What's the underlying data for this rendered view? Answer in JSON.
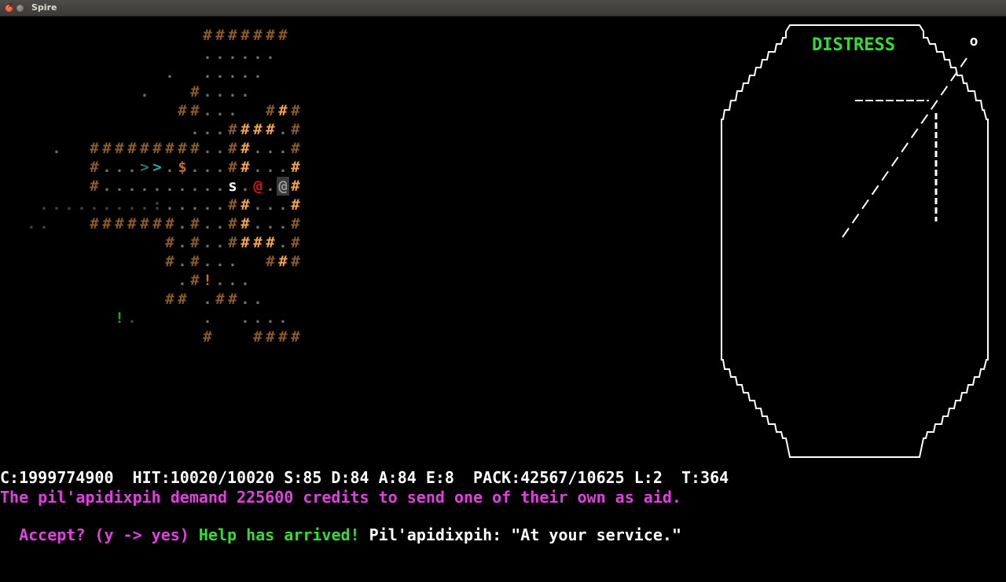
{
  "window": {
    "title": "Spire"
  },
  "colors": {
    "wall": "#8a5a2c",
    "wall_lit": "#f0a24a",
    "floor": "#6e6e6e",
    "floor_dim": "#444444",
    "credits": "#c2682c",
    "stairs": "#2aa6a6",
    "stairs_dim": "#2f6f6f",
    "enemy_red": "#dd1111",
    "npc_grey": "#8a8a8a",
    "potion_green": "#22aa22",
    "item_orange": "#d2691e",
    "text_white": "#ffffff",
    "text_magenta": "#e040e0",
    "text_green": "#33dd33",
    "distress": "#33dd33"
  },
  "map": {
    "rows": [
      {
        "y": 1,
        "cells": [
          [
            16,
            "#",
            "wall"
          ],
          [
            17,
            "#",
            "wall"
          ],
          [
            18,
            "#",
            "wall"
          ],
          [
            19,
            "#",
            "wall"
          ],
          [
            20,
            "#",
            "wall"
          ],
          [
            21,
            "#",
            "wall"
          ],
          [
            22,
            "#",
            "wall"
          ]
        ]
      },
      {
        "y": 2,
        "cells": [
          [
            16,
            ".",
            "floor"
          ],
          [
            17,
            ".",
            "floor"
          ],
          [
            18,
            ".",
            "floor"
          ],
          [
            19,
            ".",
            "floor"
          ],
          [
            20,
            ".",
            "floor"
          ],
          [
            21,
            ".",
            "floor"
          ]
        ]
      },
      {
        "y": 3,
        "cells": [
          [
            13,
            ".",
            "floor"
          ],
          [
            16,
            ".",
            "floor"
          ],
          [
            17,
            ".",
            "floor"
          ],
          [
            18,
            ".",
            "floor"
          ],
          [
            19,
            ".",
            "floor"
          ],
          [
            20,
            ".",
            "floor"
          ]
        ]
      },
      {
        "y": 4,
        "cells": [
          [
            11,
            ".",
            "floor"
          ],
          [
            15,
            "#",
            "wall"
          ],
          [
            16,
            ".",
            "floor"
          ],
          [
            17,
            ".",
            "floor"
          ],
          [
            18,
            ".",
            "floor"
          ],
          [
            19,
            ".",
            "floor"
          ]
        ]
      },
      {
        "y": 5,
        "cells": [
          [
            14,
            "#",
            "wall"
          ],
          [
            15,
            "#",
            "wall"
          ],
          [
            16,
            ".",
            "floor"
          ],
          [
            17,
            ".",
            "floor"
          ],
          [
            18,
            ".",
            "floor"
          ],
          [
            21,
            "#",
            "wall"
          ],
          [
            22,
            "#",
            "wall_lit"
          ],
          [
            23,
            "#",
            "wall"
          ]
        ]
      },
      {
        "y": 6,
        "cells": [
          [
            15,
            ".",
            "floor"
          ],
          [
            16,
            ".",
            "floor"
          ],
          [
            17,
            ".",
            "floor"
          ],
          [
            18,
            "#",
            "wall"
          ],
          [
            19,
            "#",
            "wall_lit"
          ],
          [
            20,
            "#",
            "wall_lit"
          ],
          [
            21,
            "#",
            "wall_lit"
          ],
          [
            22,
            ".",
            "floor"
          ],
          [
            23,
            "#",
            "wall"
          ]
        ]
      },
      {
        "y": 7,
        "cells": [
          [
            4,
            ".",
            "floor"
          ],
          [
            7,
            "#",
            "wall"
          ],
          [
            8,
            "#",
            "wall"
          ],
          [
            9,
            "#",
            "wall"
          ],
          [
            10,
            "#",
            "wall"
          ],
          [
            11,
            "#",
            "wall"
          ],
          [
            12,
            "#",
            "wall"
          ],
          [
            13,
            "#",
            "wall"
          ],
          [
            14,
            "#",
            "wall"
          ],
          [
            15,
            "#",
            "wall"
          ],
          [
            16,
            ".",
            "floor"
          ],
          [
            17,
            ".",
            "floor"
          ],
          [
            18,
            "#",
            "wall"
          ],
          [
            19,
            "#",
            "wall_lit"
          ],
          [
            20,
            ".",
            "floor"
          ],
          [
            21,
            ".",
            "floor"
          ],
          [
            22,
            ".",
            "floor"
          ],
          [
            23,
            "#",
            "wall"
          ]
        ]
      },
      {
        "y": 8,
        "cells": [
          [
            7,
            "#",
            "wall"
          ],
          [
            8,
            ".",
            "floor"
          ],
          [
            9,
            ".",
            "floor"
          ],
          [
            10,
            ".",
            "floor"
          ],
          [
            11,
            ">",
            "stairs_dim"
          ],
          [
            12,
            ">",
            "stairs"
          ],
          [
            13,
            ".",
            "floor"
          ],
          [
            14,
            "$",
            "credits"
          ],
          [
            15,
            ".",
            "floor"
          ],
          [
            16,
            ".",
            "floor"
          ],
          [
            17,
            ".",
            "floor"
          ],
          [
            18,
            "#",
            "wall"
          ],
          [
            19,
            "#",
            "wall_lit"
          ],
          [
            20,
            ".",
            "floor"
          ],
          [
            21,
            ".",
            "floor"
          ],
          [
            22,
            ".",
            "floor"
          ],
          [
            23,
            "#",
            "wall_lit"
          ]
        ]
      },
      {
        "y": 9,
        "cells": [
          [
            7,
            "#",
            "wall"
          ],
          [
            8,
            ".",
            "floor"
          ],
          [
            9,
            ".",
            "floor"
          ],
          [
            10,
            ".",
            "floor"
          ],
          [
            11,
            ".",
            "floor"
          ],
          [
            12,
            ".",
            "floor"
          ],
          [
            13,
            ".",
            "floor"
          ],
          [
            14,
            ".",
            "floor"
          ],
          [
            15,
            ".",
            "floor"
          ],
          [
            16,
            ".",
            "floor"
          ],
          [
            17,
            ".",
            "floor"
          ],
          [
            18,
            "s",
            "text_white"
          ],
          [
            19,
            ".",
            "floor"
          ],
          [
            20,
            "@",
            "enemy_red"
          ],
          [
            21,
            ".",
            "floor"
          ],
          [
            22,
            "@",
            "npc_grey"
          ],
          [
            23,
            "#",
            "wall_lit"
          ]
        ]
      },
      {
        "y": 10,
        "cells": [
          [
            3,
            ".",
            "floor_dim"
          ],
          [
            4,
            ".",
            "floor_dim"
          ],
          [
            5,
            ".",
            "floor_dim"
          ],
          [
            6,
            ".",
            "floor_dim"
          ],
          [
            7,
            ".",
            "floor_dim"
          ],
          [
            8,
            ".",
            "floor_dim"
          ],
          [
            9,
            ".",
            "floor_dim"
          ],
          [
            10,
            ".",
            "floor_dim"
          ],
          [
            11,
            ".",
            "floor_dim"
          ],
          [
            12,
            ":",
            "floor_dim"
          ],
          [
            13,
            ".",
            "floor"
          ],
          [
            14,
            ".",
            "floor"
          ],
          [
            15,
            ".",
            "floor"
          ],
          [
            16,
            ".",
            "floor"
          ],
          [
            17,
            ".",
            "floor"
          ],
          [
            18,
            "#",
            "wall"
          ],
          [
            19,
            "#",
            "wall_lit"
          ],
          [
            20,
            ".",
            "floor"
          ],
          [
            21,
            ".",
            "floor"
          ],
          [
            22,
            ".",
            "floor"
          ],
          [
            23,
            "#",
            "wall_lit"
          ]
        ]
      },
      {
        "y": 11,
        "cells": [
          [
            2,
            ".",
            "floor_dim"
          ],
          [
            3,
            ".",
            "floor_dim"
          ],
          [
            7,
            "#",
            "wall"
          ],
          [
            8,
            "#",
            "wall"
          ],
          [
            9,
            "#",
            "wall"
          ],
          [
            10,
            "#",
            "wall"
          ],
          [
            11,
            "#",
            "wall"
          ],
          [
            12,
            "#",
            "wall"
          ],
          [
            13,
            "#",
            "wall"
          ],
          [
            14,
            ".",
            "floor"
          ],
          [
            15,
            "#",
            "wall"
          ],
          [
            16,
            ".",
            "floor"
          ],
          [
            17,
            ".",
            "floor"
          ],
          [
            18,
            "#",
            "wall"
          ],
          [
            19,
            "#",
            "wall_lit"
          ],
          [
            20,
            ".",
            "floor"
          ],
          [
            21,
            ".",
            "floor"
          ],
          [
            22,
            ".",
            "floor"
          ],
          [
            23,
            "#",
            "wall"
          ]
        ]
      },
      {
        "y": 12,
        "cells": [
          [
            13,
            "#",
            "wall"
          ],
          [
            14,
            ".",
            "floor"
          ],
          [
            15,
            "#",
            "wall"
          ],
          [
            16,
            ".",
            "floor"
          ],
          [
            17,
            ".",
            "floor"
          ],
          [
            18,
            "#",
            "wall"
          ],
          [
            19,
            "#",
            "wall_lit"
          ],
          [
            20,
            "#",
            "wall_lit"
          ],
          [
            21,
            "#",
            "wall_lit"
          ],
          [
            22,
            ".",
            "floor"
          ],
          [
            23,
            "#",
            "wall"
          ]
        ]
      },
      {
        "y": 13,
        "cells": [
          [
            13,
            "#",
            "wall"
          ],
          [
            14,
            ".",
            "floor"
          ],
          [
            15,
            "#",
            "wall"
          ],
          [
            16,
            ".",
            "floor"
          ],
          [
            17,
            ".",
            "floor"
          ],
          [
            18,
            ".",
            "floor"
          ],
          [
            21,
            "#",
            "wall"
          ],
          [
            22,
            "#",
            "wall_lit"
          ],
          [
            23,
            "#",
            "wall"
          ]
        ]
      },
      {
        "y": 14,
        "cells": [
          [
            14,
            ".",
            "floor"
          ],
          [
            15,
            "#",
            "wall"
          ],
          [
            16,
            "!",
            "item_orange"
          ],
          [
            17,
            ".",
            "floor"
          ],
          [
            18,
            ".",
            "floor"
          ],
          [
            19,
            ".",
            "floor"
          ]
        ]
      },
      {
        "y": 15,
        "cells": [
          [
            13,
            "#",
            "wall"
          ],
          [
            14,
            "#",
            "wall"
          ],
          [
            16,
            ".",
            "floor"
          ],
          [
            17,
            "#",
            "wall"
          ],
          [
            18,
            "#",
            "wall"
          ],
          [
            19,
            ".",
            "floor"
          ],
          [
            20,
            ".",
            "floor"
          ]
        ]
      },
      {
        "y": 16,
        "cells": [
          [
            9,
            "!",
            "potion_green"
          ],
          [
            10,
            ".",
            "floor_dim"
          ],
          [
            16,
            ".",
            "floor"
          ],
          [
            19,
            ".",
            "floor"
          ],
          [
            20,
            ".",
            "floor"
          ],
          [
            21,
            ".",
            "floor"
          ],
          [
            22,
            ".",
            "floor"
          ]
        ]
      },
      {
        "y": 17,
        "cells": [
          [
            16,
            "#",
            "wall"
          ],
          [
            20,
            "#",
            "wall"
          ],
          [
            21,
            "#",
            "wall"
          ],
          [
            22,
            "#",
            "wall"
          ],
          [
            23,
            "#",
            "wall"
          ]
        ]
      }
    ]
  },
  "radar": {
    "label": "DISTRESS",
    "marker": "o"
  },
  "status": {
    "line": "C:1999774900  HIT:10020/10020 S:85 D:84 A:84 E:8  PACK:42567/10625 L:2  T:364"
  },
  "messages": {
    "line1": "The pil'apidixpih demand 225600 credits to send one of their own as aid.",
    "prompt": "Accept? (y -> yes) ",
    "arrived": "Help has arrived! ",
    "speech": "Pil'apidixpih: \"At your service.\""
  }
}
